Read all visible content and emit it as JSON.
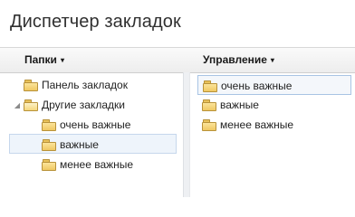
{
  "window": {
    "title": "Диспетчер закладок"
  },
  "toolbar": {
    "folders_menu": "Папки",
    "manage_menu": "Управление",
    "caret": "▾"
  },
  "tree": {
    "expand_glyph": "◢",
    "items": [
      {
        "label": "Панель закладок"
      },
      {
        "label": "Другие закладки"
      },
      {
        "label": "очень важные"
      },
      {
        "label": "важные",
        "selected": true
      },
      {
        "label": "менее важные"
      }
    ]
  },
  "list": {
    "items": [
      {
        "label": "очень важные",
        "selected": true
      },
      {
        "label": "важные"
      },
      {
        "label": "менее важные"
      }
    ]
  },
  "colors": {
    "folder_fill": "#f0c862",
    "folder_outline": "#b8923a",
    "selection_border": "#a9c4e4"
  }
}
